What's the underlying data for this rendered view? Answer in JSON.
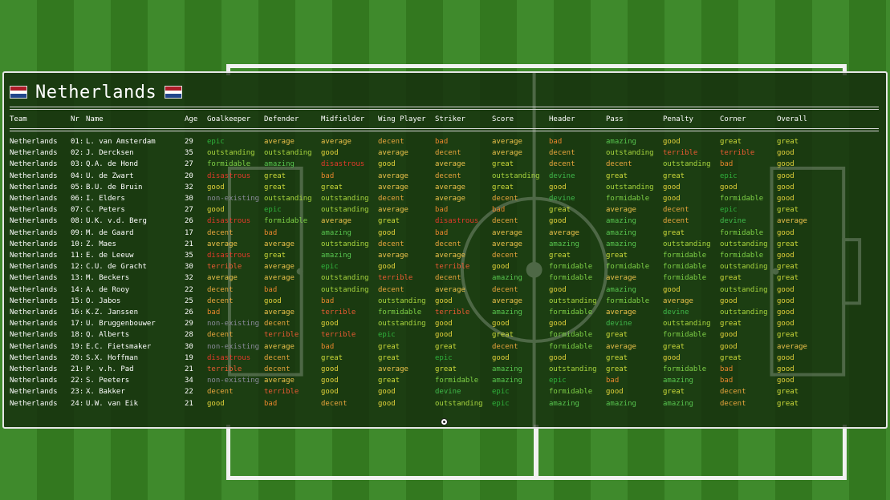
{
  "team_title": "Netherlands",
  "flag_colors": [
    "#ae1c28",
    "#ffffff",
    "#21468b"
  ],
  "rating_colors": {
    "non-existing": "#8a8a9a",
    "disastrous": "#e53a2a",
    "terrible": "#e85a32",
    "bad": "#e6862c",
    "decent": "#e8a53c",
    "average": "#ecc24a",
    "good": "#e2d23a",
    "great": "#cfdc3a",
    "outstanding": "#a9d63e",
    "formidable": "#7ed046",
    "amazing": "#57c44e",
    "devine": "#3fb84a",
    "epic": "#2fb03a"
  },
  "columns": [
    "Team",
    "Nr",
    "Name",
    "Age",
    "Goalkeeper",
    "Defender",
    "Midfielder",
    "Wing Player",
    "Striker",
    "Score",
    "Header",
    "Pass",
    "Penalty",
    "Corner",
    "Overall"
  ],
  "players": [
    {
      "team": "Netherlands",
      "nr": "01:",
      "name": "L. van Amsterdam",
      "age": "29",
      "ratings": [
        "epic",
        "average",
        "average",
        "decent",
        "bad",
        "average",
        "bad",
        "amazing",
        "good",
        "great",
        "great"
      ]
    },
    {
      "team": "Netherlands",
      "nr": "02:",
      "name": "J. Dercksen",
      "age": "35",
      "ratings": [
        "outstanding",
        "outstanding",
        "good",
        "average",
        "decent",
        "average",
        "decent",
        "outstanding",
        "terrible",
        "terrible",
        "good"
      ]
    },
    {
      "team": "Netherlands",
      "nr": "03:",
      "name": "Q.A. de Hond",
      "age": "27",
      "ratings": [
        "formidable",
        "amazing",
        "disastrous",
        "good",
        "average",
        "great",
        "decent",
        "decent",
        "outstanding",
        "bad",
        "good"
      ]
    },
    {
      "team": "Netherlands",
      "nr": "04:",
      "name": "U. de Zwart",
      "age": "20",
      "ratings": [
        "disastrous",
        "great",
        "bad",
        "average",
        "decent",
        "outstanding",
        "devine",
        "great",
        "great",
        "epic",
        "good"
      ]
    },
    {
      "team": "Netherlands",
      "nr": "05:",
      "name": "B.U. de Bruin",
      "age": "32",
      "ratings": [
        "good",
        "great",
        "great",
        "average",
        "average",
        "great",
        "good",
        "outstanding",
        "good",
        "good",
        "good"
      ]
    },
    {
      "team": "Netherlands",
      "nr": "06:",
      "name": "I. Elders",
      "age": "30",
      "ratings": [
        "non-existing",
        "outstanding",
        "outstanding",
        "decent",
        "average",
        "decent",
        "devine",
        "formidable",
        "good",
        "formidable",
        "good"
      ]
    },
    {
      "team": "Netherlands",
      "nr": "07:",
      "name": "C. Peters",
      "age": "27",
      "ratings": [
        "good",
        "epic",
        "outstanding",
        "average",
        "bad",
        "bad",
        "great",
        "average",
        "decent",
        "epic",
        "great"
      ]
    },
    {
      "team": "Netherlands",
      "nr": "08:",
      "name": "U.K. v.d. Berg",
      "age": "26",
      "ratings": [
        "disastrous",
        "formidable",
        "average",
        "great",
        "disastrous",
        "decent",
        "good",
        "amazing",
        "decent",
        "devine",
        "average"
      ]
    },
    {
      "team": "Netherlands",
      "nr": "09:",
      "name": "M. de Gaard",
      "age": "17",
      "ratings": [
        "decent",
        "bad",
        "amazing",
        "good",
        "bad",
        "average",
        "average",
        "amazing",
        "great",
        "formidable",
        "good"
      ]
    },
    {
      "team": "Netherlands",
      "nr": "10:",
      "name": "Z. Maes",
      "age": "21",
      "ratings": [
        "average",
        "average",
        "outstanding",
        "decent",
        "decent",
        "average",
        "amazing",
        "amazing",
        "outstanding",
        "outstanding",
        "great"
      ]
    },
    {
      "team": "Netherlands",
      "nr": "11:",
      "name": "E. de Leeuw",
      "age": "35",
      "ratings": [
        "disastrous",
        "great",
        "amazing",
        "average",
        "average",
        "decent",
        "great",
        "great",
        "formidable",
        "formidable",
        "good"
      ]
    },
    {
      "team": "Netherlands",
      "nr": "12:",
      "name": "C.U. de Gracht",
      "age": "30",
      "ratings": [
        "terrible",
        "average",
        "epic",
        "good",
        "terrible",
        "good",
        "formidable",
        "formidable",
        "formidable",
        "outstanding",
        "great"
      ]
    },
    {
      "team": "Netherlands",
      "nr": "13:",
      "name": "M. Beckers",
      "age": "32",
      "ratings": [
        "average",
        "average",
        "outstanding",
        "terrible",
        "decent",
        "amazing",
        "formidable",
        "average",
        "formidable",
        "great",
        "great"
      ]
    },
    {
      "team": "Netherlands",
      "nr": "14:",
      "name": "A. de Rooy",
      "age": "22",
      "ratings": [
        "decent",
        "bad",
        "outstanding",
        "decent",
        "average",
        "decent",
        "good",
        "amazing",
        "good",
        "outstanding",
        "good"
      ]
    },
    {
      "team": "Netherlands",
      "nr": "15:",
      "name": "O. Jabos",
      "age": "25",
      "ratings": [
        "decent",
        "good",
        "bad",
        "outstanding",
        "good",
        "average",
        "outstanding",
        "formidable",
        "average",
        "good",
        "good"
      ]
    },
    {
      "team": "Netherlands",
      "nr": "16:",
      "name": "K.Z. Janssen",
      "age": "26",
      "ratings": [
        "bad",
        "average",
        "terrible",
        "formidable",
        "terrible",
        "amazing",
        "formidable",
        "average",
        "devine",
        "outstanding",
        "good"
      ]
    },
    {
      "team": "Netherlands",
      "nr": "17:",
      "name": "U. Bruggenbouwer",
      "age": "29",
      "ratings": [
        "non-existing",
        "decent",
        "good",
        "outstanding",
        "good",
        "good",
        "good",
        "devine",
        "outstanding",
        "great",
        "good"
      ]
    },
    {
      "team": "Netherlands",
      "nr": "18:",
      "name": "Q. Alberts",
      "age": "28",
      "ratings": [
        "decent",
        "terrible",
        "terrible",
        "epic",
        "good",
        "great",
        "formidable",
        "great",
        "formidable",
        "good",
        "great"
      ]
    },
    {
      "team": "Netherlands",
      "nr": "19:",
      "name": "E.C. Fietsmaker",
      "age": "30",
      "ratings": [
        "non-existing",
        "average",
        "bad",
        "great",
        "great",
        "decent",
        "formidable",
        "average",
        "great",
        "good",
        "average"
      ]
    },
    {
      "team": "Netherlands",
      "nr": "20:",
      "name": "S.X. Hoffman",
      "age": "19",
      "ratings": [
        "disastrous",
        "decent",
        "great",
        "great",
        "epic",
        "good",
        "good",
        "great",
        "good",
        "great",
        "good"
      ]
    },
    {
      "team": "Netherlands",
      "nr": "21:",
      "name": "P. v.h. Pad",
      "age": "21",
      "ratings": [
        "terrible",
        "decent",
        "good",
        "average",
        "great",
        "amazing",
        "outstanding",
        "great",
        "formidable",
        "bad",
        "good"
      ]
    },
    {
      "team": "Netherlands",
      "nr": "22:",
      "name": "S. Peeters",
      "age": "34",
      "ratings": [
        "non-existing",
        "average",
        "good",
        "great",
        "formidable",
        "amazing",
        "epic",
        "bad",
        "amazing",
        "bad",
        "good"
      ]
    },
    {
      "team": "Netherlands",
      "nr": "23:",
      "name": "X. Bakker",
      "age": "22",
      "ratings": [
        "decent",
        "terrible",
        "good",
        "good",
        "devine",
        "epic",
        "formidable",
        "good",
        "great",
        "decent",
        "great"
      ]
    },
    {
      "team": "Netherlands",
      "nr": "24:",
      "name": "U.W. van Eik",
      "age": "21",
      "ratings": [
        "good",
        "bad",
        "decent",
        "good",
        "outstanding",
        "epic",
        "amazing",
        "amazing",
        "amazing",
        "decent",
        "great"
      ]
    }
  ]
}
